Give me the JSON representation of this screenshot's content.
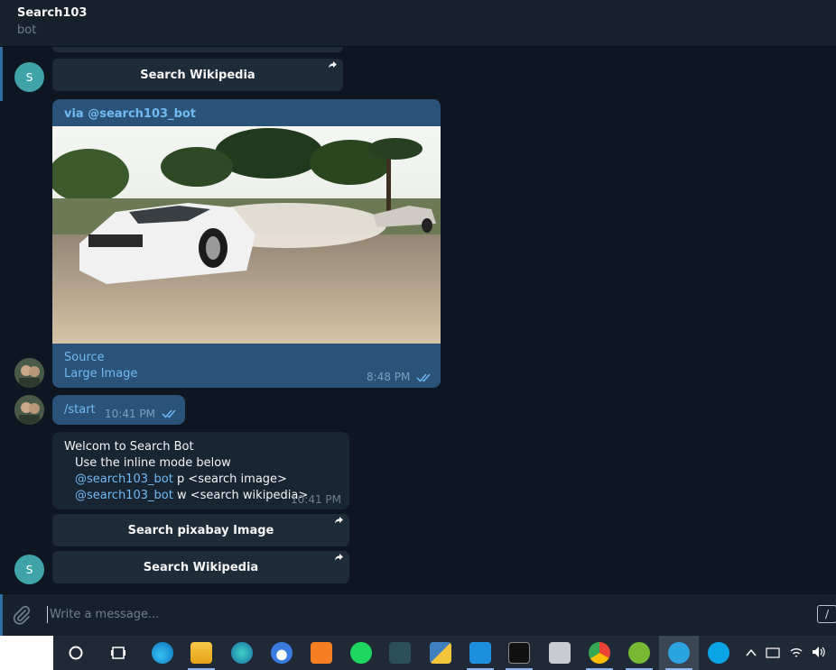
{
  "header": {
    "title": "Search103",
    "status": "bot"
  },
  "messages": {
    "kb_top": {
      "label": "Search Wikipedia"
    },
    "avatar_bot_letter": "S",
    "photo": {
      "via": "via @search103_bot",
      "source": "Source",
      "large_image": "Large Image",
      "time": "8:48 PM"
    },
    "start": {
      "text": "/start",
      "time": "10:41 PM"
    },
    "welcome": {
      "line1": "Welcom to Search Bot",
      "line2": "Use the inline mode below",
      "line3_mention": "@search103_bot",
      "line3_rest": " p <search image>",
      "line4_mention": "@search103_bot",
      "line4_rest": " w <search wikipedia>",
      "time": "10:41 PM"
    },
    "kb_pixabay": {
      "label": "Search pixabay Image"
    },
    "kb_wiki": {
      "label": "Search Wikipedia"
    }
  },
  "composer": {
    "placeholder": "Write a message...",
    "command_icon_glyph": "/"
  },
  "colors": {
    "bg": "#0e1621",
    "panel": "#17212b",
    "outgoing": "#2b5278",
    "incoming": "#182533",
    "link": "#71baf2",
    "accent": "#2f6ea5"
  },
  "taskbar": {
    "icons": [
      "task-view-icon",
      "edge-icon",
      "file-explorer-icon",
      "edge-beta-icon",
      "bot-app-icon",
      "xampp-icon",
      "spotify-icon",
      "counter-strike-icon",
      "python-installer-icon",
      "vscode-icon",
      "terminal-icon",
      "network-drive-icon",
      "chrome-icon",
      "utorrent-icon",
      "telegram-icon",
      "skype-icon"
    ],
    "tray_icons": [
      "chevron-up-icon",
      "keyboard-icon",
      "wifi-icon",
      "volume-icon"
    ]
  }
}
